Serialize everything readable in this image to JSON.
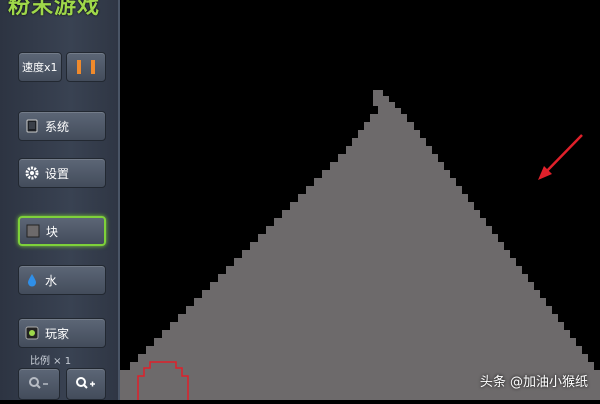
{
  "app": {
    "title": "粉末游戏"
  },
  "sidebar": {
    "speed_label": "速度x1",
    "system_label": "系统",
    "settings_label": "设置",
    "block_label": "块",
    "water_label": "水",
    "player_label": "玩家",
    "scale_label": "比例 × 1"
  },
  "watermark": {
    "platform": "头条",
    "author": "@加油小猴纸"
  },
  "colors": {
    "sand": "#6d6a6b",
    "accent_green": "#7ed13a",
    "arrow_red": "#e0202a",
    "selection_red": "#e0202a"
  }
}
